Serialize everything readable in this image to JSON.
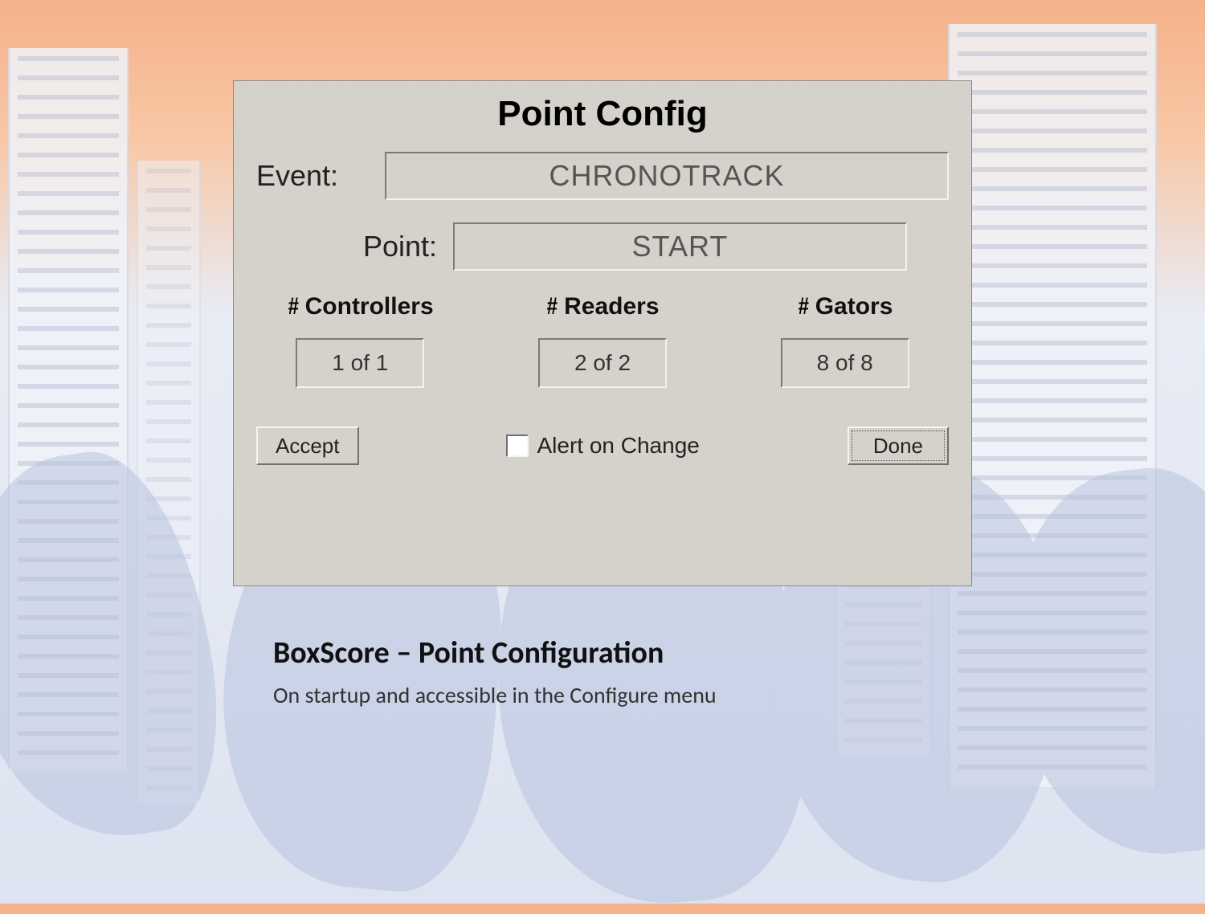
{
  "dialog": {
    "title": "Point Config",
    "event_label": "Event:",
    "event_value": "CHRONOTRACK",
    "point_label": "Point:",
    "point_value": "START",
    "counts": [
      {
        "header": "Controllers",
        "value": "1 of 1"
      },
      {
        "header": "Readers",
        "value": "2 of 2"
      },
      {
        "header": "Gators",
        "value": "8 of 8"
      }
    ],
    "accept_label": "Accept",
    "alert_label": "Alert on Change",
    "done_label": "Done"
  },
  "caption": {
    "heading": "BoxScore – Point Configuration",
    "sub": "On startup and accessible in the Configure menu"
  }
}
